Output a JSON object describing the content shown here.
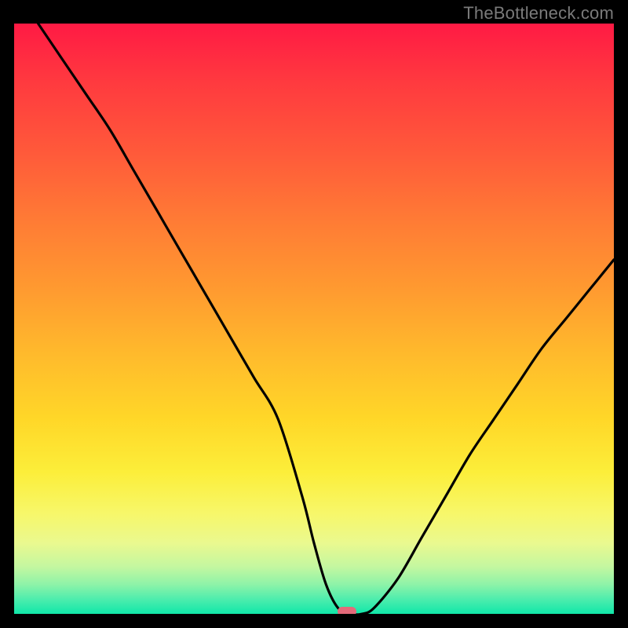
{
  "watermark": "TheBottleneck.com",
  "chart_data": {
    "type": "line",
    "title": "",
    "xlabel": "",
    "ylabel": "",
    "xlim": [
      0,
      100
    ],
    "ylim": [
      0,
      100
    ],
    "grid": false,
    "series": [
      {
        "name": "bottleneck-curve",
        "x": [
          4,
          8,
          12,
          16,
          20,
          24,
          28,
          32,
          36,
          40,
          44,
          48,
          50,
          52,
          54,
          56,
          58,
          60,
          64,
          68,
          72,
          76,
          80,
          84,
          88,
          92,
          96,
          100
        ],
        "y": [
          100,
          94,
          88,
          82,
          75,
          68,
          61,
          54,
          47,
          40,
          33,
          20,
          12,
          5,
          1,
          0,
          0,
          1,
          6,
          13,
          20,
          27,
          33,
          39,
          45,
          50,
          55,
          60
        ]
      }
    ],
    "marker": {
      "x_norm": 0.555,
      "y_norm": 0.996,
      "color": "#e46a7a",
      "shape": "rounded-rect"
    },
    "background_gradient_stops": [
      {
        "pos": 0.0,
        "color": "#ff1a44"
      },
      {
        "pos": 0.33,
        "color": "#ff7a35"
      },
      {
        "pos": 0.67,
        "color": "#ffd728"
      },
      {
        "pos": 0.88,
        "color": "#eaf98f"
      },
      {
        "pos": 1.0,
        "color": "#10e7a9"
      }
    ]
  }
}
